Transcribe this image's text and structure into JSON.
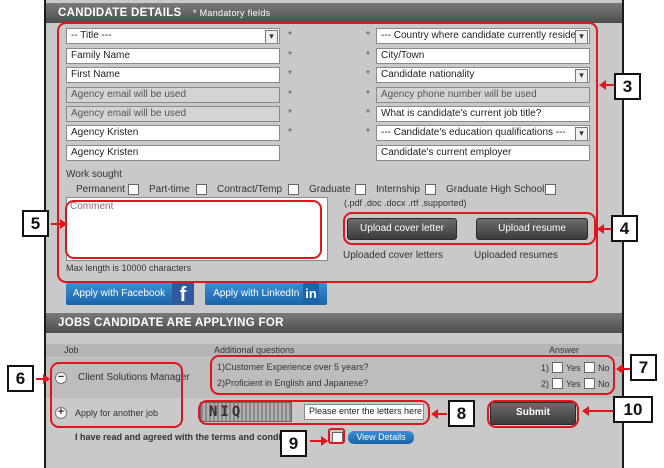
{
  "header": {
    "title": "CANDIDATE DETAILS",
    "mandatory": "* Mandatory fields"
  },
  "left_fields": [
    {
      "value": "-- Title ---"
    },
    {
      "value": "Family Name"
    },
    {
      "value": "First Name"
    },
    {
      "value": "Agency email will be used"
    },
    {
      "value": "Agency email will be used"
    },
    {
      "value": "Agency Kristen"
    },
    {
      "value": "Agency Kristen"
    }
  ],
  "right_fields": [
    {
      "value": "--- Country where candidate currently reside"
    },
    {
      "value": "City/Town"
    },
    {
      "value": "Candidate nationality"
    },
    {
      "value": "Agency phone number will be used"
    },
    {
      "value": "What is candidate's current job title?"
    },
    {
      "value": "--- Candidate's education qualifications ---"
    },
    {
      "value": "Candidate's current employer"
    }
  ],
  "star": "*",
  "work_sought": {
    "label": "Work sought",
    "options": [
      "Permanent",
      "Part-time",
      "Contract/Temp",
      "Graduate",
      "Internship",
      "Graduate High School"
    ]
  },
  "comment": {
    "placeholder": "Comment",
    "max_length": "Max length is 10000 characters"
  },
  "upload": {
    "supported": "(.pdf .doc .docx .rtf .supported)",
    "cover_btn": "Upload cover letter",
    "resume_btn": "Upload resume",
    "uploaded_cover": "Uploaded cover letters",
    "uploaded_resume": "Uploaded resumes"
  },
  "social": {
    "facebook": "Apply with Facebook",
    "facebook_badge": "f",
    "linkedin": "Apply with LinkedIn",
    "linkedin_badge": "in"
  },
  "jobs": {
    "title": "JOBS CANDIDATE ARE APPLYING FOR",
    "col_job": "Job",
    "col_questions": "Additional questions",
    "col_answer": "Answer",
    "job_name": "Client Solutions Manager",
    "another": "Apply for another job",
    "q1": "1)Customer Experience over 5 years?",
    "q2": "2)Proficient in English and Japanese?",
    "ans1_idx": "1)",
    "ans2_idx": "2)",
    "yes": "Yes",
    "no": "No"
  },
  "captcha": {
    "image_text": "NIQ",
    "placeholder": "Please enter the letters here"
  },
  "submit": "Submit",
  "terms": {
    "text": "I have read and agreed with the terms and condi",
    "view": "View Details"
  },
  "callouts": [
    "3",
    "4",
    "5",
    "6",
    "7",
    "8",
    "9",
    "10"
  ],
  "colors": {
    "accent_red": "#e0161c",
    "header_grey": "#5a5a5a",
    "button_blue": "#1a64a8"
  }
}
